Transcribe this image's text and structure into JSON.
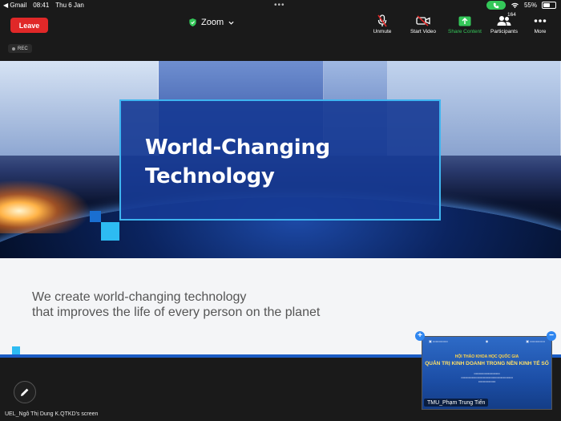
{
  "status_bar": {
    "carrier_back": "◀ Gmail",
    "time": "08:41",
    "date": "Thu 6 Jan",
    "battery_level": "55%"
  },
  "toolbar": {
    "leave_label": "Leave",
    "app_title": "Zoom",
    "unmute_label": "Unmute",
    "start_video_label": "Start Video",
    "share_content_label": "Share Content",
    "participants_label": "Participants",
    "participants_count": "164",
    "more_label": "More"
  },
  "recording": {
    "label": "REC"
  },
  "slide": {
    "title_line1": "World-Changing",
    "title_line2": "Technology",
    "tagline_line1": "We create world-changing technology",
    "tagline_line2": "that improves the life of every person on the planet"
  },
  "screen_share": {
    "owner_label": "UEL_Ngô Thị Dung K.QTKD's screen"
  },
  "thumbnail": {
    "participant_name": "TMU_Phạm Trung Tiến",
    "slide_heading": "HỘI THẢO KHOA HỌC QUỐC GIA",
    "slide_title": "QUẢN TRỊ KINH DOANH TRONG NỀN KINH TẾ SỐ",
    "expand_symbol": "+",
    "collapse_symbol": "−"
  },
  "colors": {
    "leave": "#e02828",
    "share_green": "#34c759",
    "slide_title_box": "#163a94",
    "accent_blue": "#2dbbf2"
  }
}
